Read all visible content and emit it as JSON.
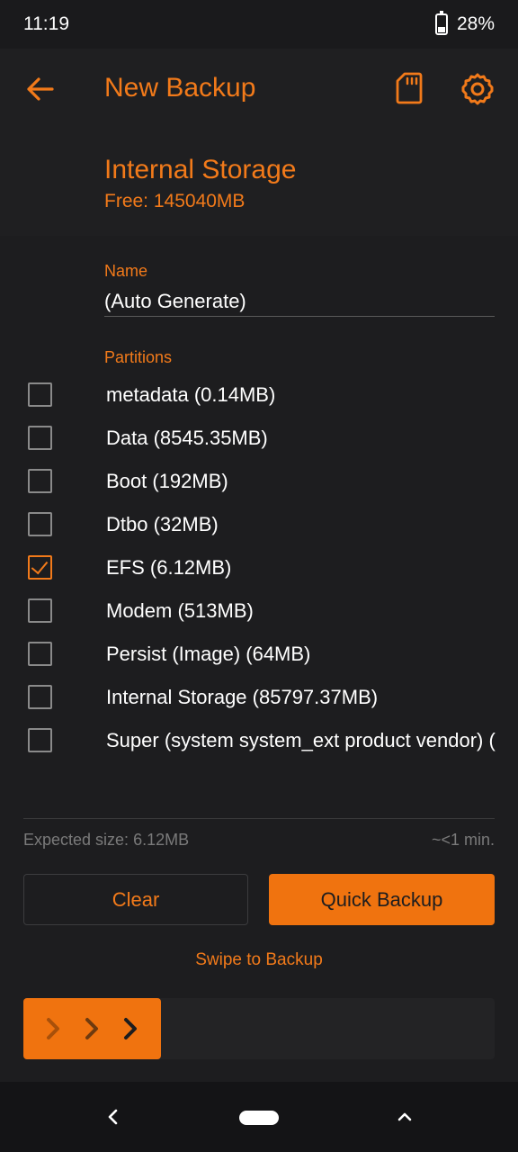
{
  "status": {
    "time": "11:19",
    "battery": "28%"
  },
  "appbar": {
    "title": "New Backup"
  },
  "storage": {
    "name": "Internal Storage",
    "free": "Free: 145040MB"
  },
  "name_field": {
    "label": "Name",
    "value": "(Auto Generate)"
  },
  "partitions": {
    "label": "Partitions",
    "items": [
      {
        "label": "metadata (0.14MB)",
        "checked": false
      },
      {
        "label": "Data (8545.35MB)",
        "checked": false
      },
      {
        "label": "Boot (192MB)",
        "checked": false
      },
      {
        "label": "Dtbo (32MB)",
        "checked": false
      },
      {
        "label": "EFS (6.12MB)",
        "checked": true
      },
      {
        "label": "Modem (513MB)",
        "checked": false
      },
      {
        "label": "Persist (Image) (64MB)",
        "checked": false
      },
      {
        "label": "Internal Storage (85797.37MB)",
        "checked": false
      },
      {
        "label": "Super (system system_ext product vendor) (",
        "checked": false
      }
    ]
  },
  "summary": {
    "expected_label": "Expected size:  6.12MB",
    "time": "~<1 min."
  },
  "buttons": {
    "clear": "Clear",
    "quick_backup": "Quick Backup"
  },
  "swipe": {
    "label": "Swipe to Backup"
  },
  "colors": {
    "accent": "#f27a1a",
    "background": "#1d1d1f"
  }
}
